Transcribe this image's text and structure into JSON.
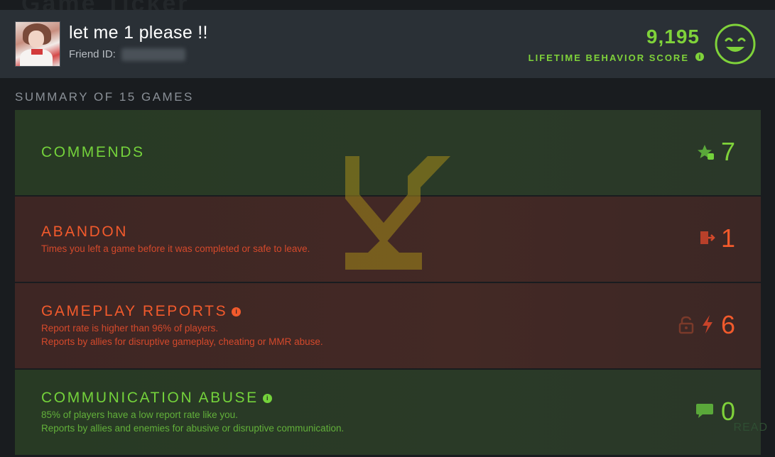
{
  "header": {
    "ghost_title": "Game Ticker",
    "username": "let me 1 please !!",
    "friend_id_label": "Friend ID:",
    "friend_id_value": "000000000",
    "behavior_score": "9,195",
    "behavior_score_label": "LIFETIME BEHAVIOR SCORE",
    "info_glyph": "i",
    "score_color": "#7fd23a"
  },
  "summary": {
    "title": "SUMMARY OF 15 GAMES"
  },
  "cards": [
    {
      "title": "COMMENDS",
      "descriptions": [],
      "count": "7",
      "icon": "star-thumbs-up-icon",
      "color": "#74d23b"
    },
    {
      "title": "ABANDON",
      "descriptions": [
        "Times you left a game before it was completed or safe to leave."
      ],
      "count": "1",
      "icon": "exit-door-icon",
      "color": "#f25a2c"
    },
    {
      "title": "GAMEPLAY REPORTS",
      "descriptions": [
        "Report rate is higher than 96% of players.",
        "Reports by allies for disruptive gameplay, cheating or MMR abuse."
      ],
      "count": "6",
      "icon": "lock-lightning-icon",
      "color": "#f25a2c"
    },
    {
      "title": "COMMUNICATION ABUSE",
      "descriptions": [
        "85% of players have a low report rate like you.",
        "Reports by allies and enemies for abusive or disruptive communication."
      ],
      "count": "0",
      "icon": "chat-bubble-icon",
      "color": "#74d23b"
    }
  ],
  "footer_ghost": "READ"
}
